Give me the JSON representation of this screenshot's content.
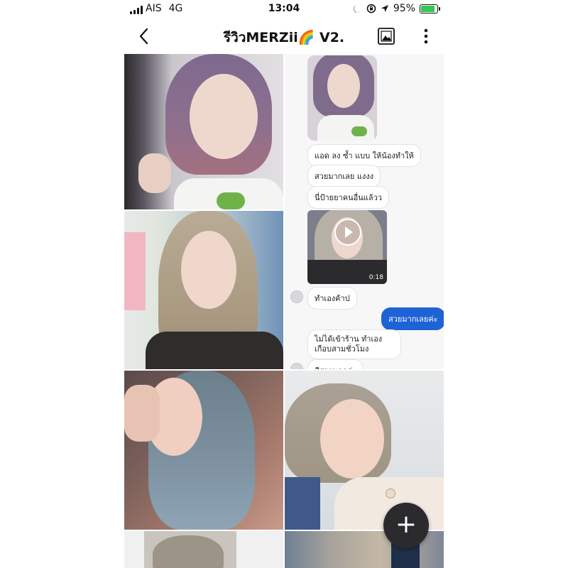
{
  "status_bar": {
    "carrier": "AIS",
    "network": "4G",
    "time": "13:04",
    "battery": "95%",
    "battery_level": 0.95
  },
  "header": {
    "title": "รีวิวMERZii🌈 V2."
  },
  "chat": {
    "messages": [
      {
        "text": "แอด ลง ซ้ำ แบบ ให้น้องทำให้"
      },
      {
        "text": "สวยมากเลย แงงง"
      },
      {
        "text": "นี่ป้ายยาคนอื่นแล้วว"
      },
      {
        "text": "ทำเองค้าป"
      },
      {
        "text": "สวยมากเลยค่ะ"
      },
      {
        "text": "ไม่ได้เข้าร้าน ทำเองเกือบสามชั่วโมง"
      },
      {
        "text": "สีสวยมากค่ะ"
      }
    ],
    "video_duration": "0:18"
  },
  "fab": {
    "label": "+"
  }
}
